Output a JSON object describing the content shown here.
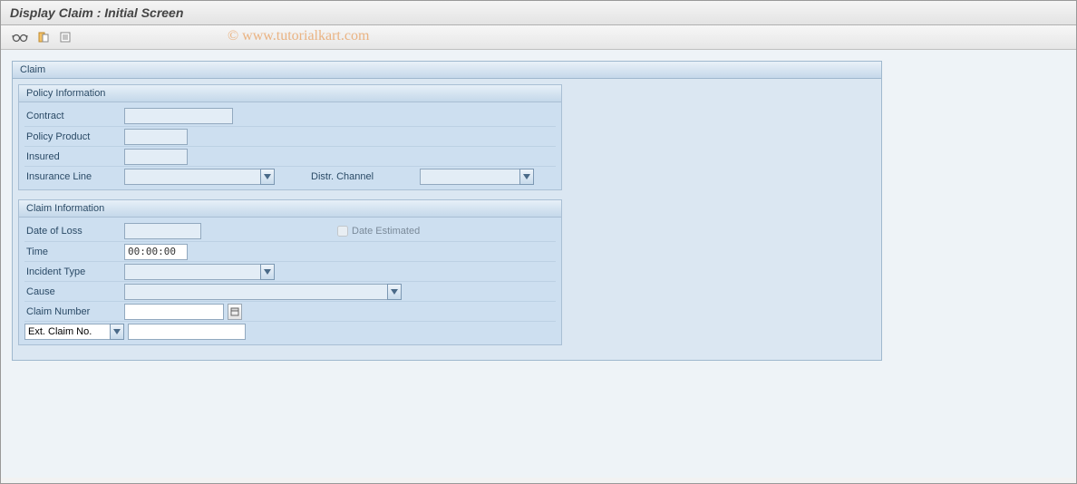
{
  "title": "Display Claim : Initial Screen",
  "watermark": "© www.tutorialkart.com",
  "panel": {
    "title": "Claim"
  },
  "policy": {
    "title": "Policy Information",
    "contract_label": "Contract",
    "contract_value": "",
    "product_label": "Policy Product",
    "product_value": "",
    "insured_label": "Insured",
    "insured_value": "",
    "line_label": "Insurance Line",
    "line_value": "",
    "dist_label": "Distr. Channel",
    "dist_value": ""
  },
  "claim": {
    "title": "Claim Information",
    "date_label": "Date of Loss",
    "date_value": "",
    "date_est_label": "Date Estimated",
    "time_label": "Time",
    "time_value": "00:00:00",
    "incident_label": "Incident Type",
    "incident_value": "",
    "cause_label": "Cause",
    "cause_value": "",
    "number_label": "Claim Number",
    "number_value": "",
    "ext_label": "Ext. Claim No.",
    "ext_value": ""
  }
}
